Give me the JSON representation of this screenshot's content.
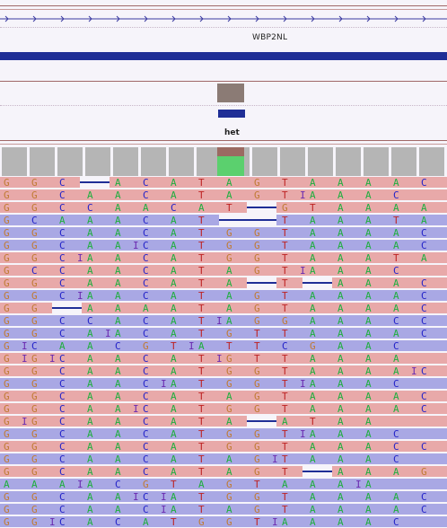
{
  "gene": {
    "name": "WBP2NL"
  },
  "genotype": {
    "call": "het"
  },
  "colors": {
    "A": "#1eae3e",
    "C": "#2323c8",
    "G": "#c07a33",
    "T": "#bd2323",
    "forward_read": "#e8a9a9",
    "reverse_read": "#a9a8e4",
    "gene_bar": "#1f2e96",
    "het_swatch": "#8b7b75"
  },
  "reference_columns": [
    "G",
    "G",
    "C",
    "A",
    "A",
    "C",
    "A",
    "T",
    "A",
    "G",
    "T",
    "A",
    "A",
    "A",
    "A",
    "C"
  ],
  "reads": [
    {
      "strand": "f",
      "bases": "GGC..ACATAGTAAAAC"
    },
    {
      "strand": "f",
      "bases": "GGCAACATAGTIAAAC"
    },
    {
      "strand": "f",
      "bases": "GGCCAACAT..GTAAAAC"
    },
    {
      "strand": "r",
      "bases": "GCAAACAT....TAAATAA"
    },
    {
      "strand": "r",
      "bases": "GGCAACATGGTAAAAC"
    },
    {
      "strand": "r",
      "bases": "GGCAAICATGGTAAAAC"
    },
    {
      "strand": "f",
      "bases": "GGCIAACATGGTAAATAC"
    },
    {
      "strand": "f",
      "bases": "GCCAACATAGTIAAAC"
    },
    {
      "strand": "f",
      "bases": "GGCAACATA..T..AAAC"
    },
    {
      "strand": "r",
      "bases": "GGCIAACATAGTAAAAC"
    },
    {
      "strand": "f",
      "bases": "GG..AAAATAGTAAAAC"
    },
    {
      "strand": "r",
      "bases": "GGCCACATIAGGAAACC"
    },
    {
      "strand": "r",
      "bases": "GGCAIACATGTTAAAAC"
    },
    {
      "strand": "r",
      "bases": "GICAACGTIATTCGAAC"
    },
    {
      "strand": "f",
      "bases": "GIGICAACATIGTTAAAA"
    },
    {
      "strand": "f",
      "bases": "GGCAACATGGTAAAAIC"
    },
    {
      "strand": "r",
      "bases": "GGCAACIATGGTIAAAC"
    },
    {
      "strand": "f",
      "bases": "GGCAACATAGTAAAAC"
    },
    {
      "strand": "f",
      "bases": "GGCAAICATGGTAAAAC"
    },
    {
      "strand": "f",
      "bases": "GIGCAACATA..ATAA"
    },
    {
      "strand": "r",
      "bases": "GGCAACATGGTIAAAC"
    },
    {
      "strand": "f",
      "bases": "GGCAACATGGTAAACC"
    },
    {
      "strand": "r",
      "bases": "GGCAACATAGITAAAC"
    },
    {
      "strand": "f",
      "bases": "GGCAACATAGT..AAAG"
    },
    {
      "strand": "r",
      "bases": "AAAIACGTAGTAAAIA"
    },
    {
      "strand": "r",
      "bases": "GGCAAICIATGGTAAAAC"
    },
    {
      "strand": "r",
      "bases": "GGCAACIATAGTAAAAC"
    },
    {
      "strand": "r",
      "bases": "GGICACATGGTIAAAAC"
    }
  ]
}
